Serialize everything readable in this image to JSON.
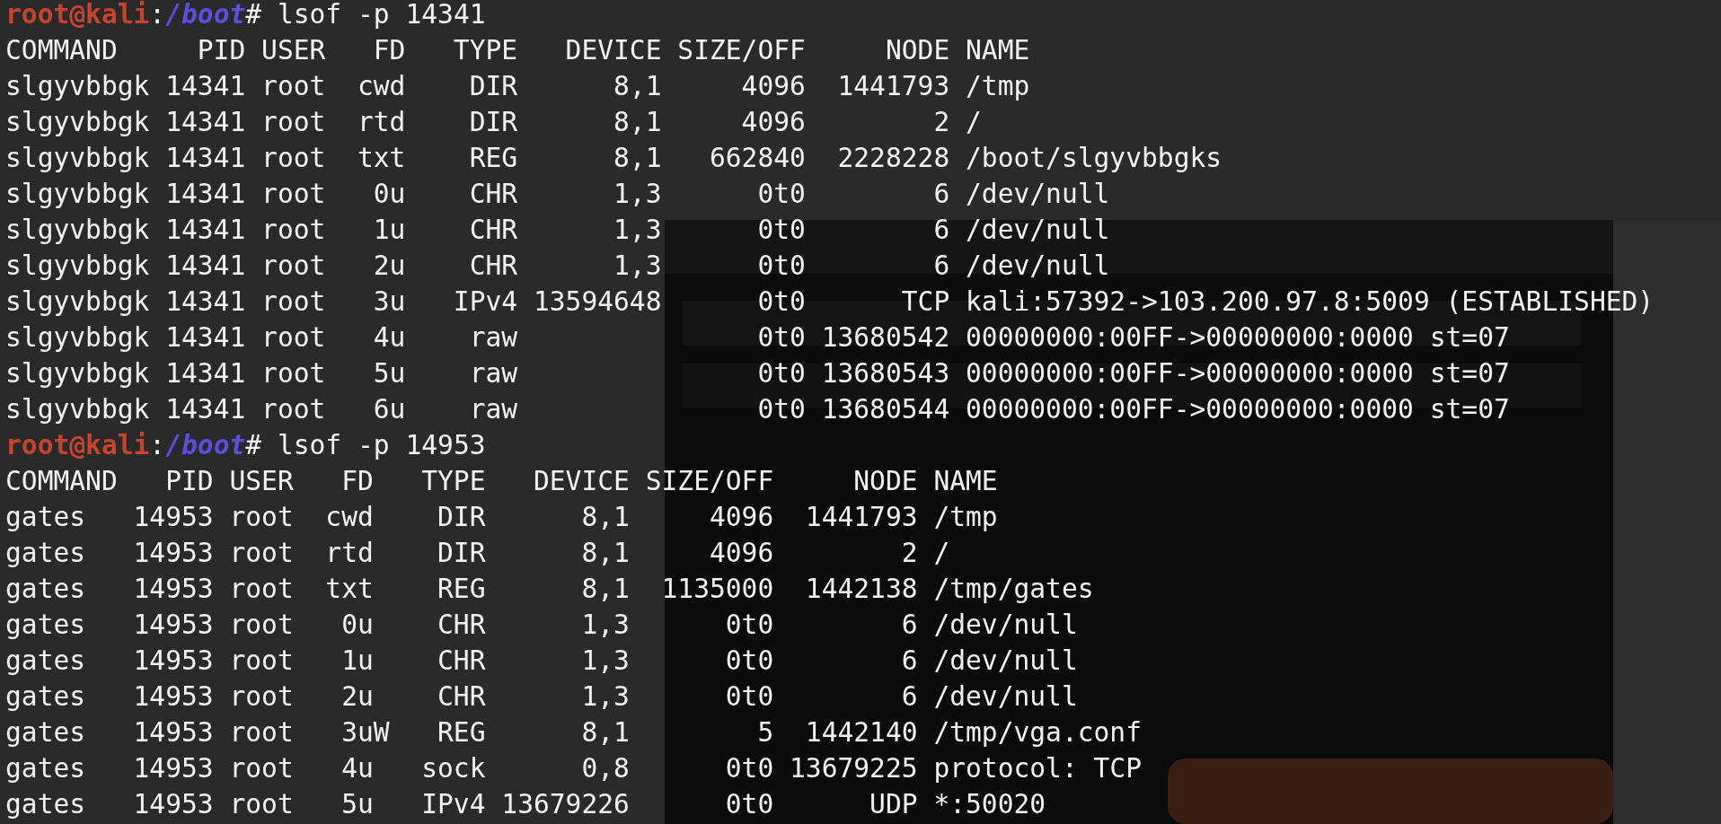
{
  "terminal": {
    "lines": [
      {
        "kind": "prompt",
        "user": "root@kali",
        "sep": ":",
        "path": "/boot",
        "command": "# lsof -p 14341"
      },
      {
        "kind": "output",
        "text": "COMMAND     PID USER   FD   TYPE   DEVICE SIZE/OFF     NODE NAME"
      },
      {
        "kind": "output",
        "text": "slgyvbbgk 14341 root  cwd    DIR      8,1     4096  1441793 /tmp"
      },
      {
        "kind": "output",
        "text": "slgyvbbgk 14341 root  rtd    DIR      8,1     4096        2 /"
      },
      {
        "kind": "output",
        "text": "slgyvbbgk 14341 root  txt    REG      8,1   662840  2228228 /boot/slgyvbbgks"
      },
      {
        "kind": "output",
        "text": "slgyvbbgk 14341 root   0u    CHR      1,3      0t0        6 /dev/null"
      },
      {
        "kind": "output",
        "text": "slgyvbbgk 14341 root   1u    CHR      1,3      0t0        6 /dev/null"
      },
      {
        "kind": "output",
        "text": "slgyvbbgk 14341 root   2u    CHR      1,3      0t0        6 /dev/null"
      },
      {
        "kind": "output",
        "text": "slgyvbbgk 14341 root   3u   IPv4 13594648      0t0      TCP kali:57392->103.200.97.8:5009 (ESTABLISHED)"
      },
      {
        "kind": "output",
        "text": "slgyvbbgk 14341 root   4u    raw               0t0 13680542 00000000:00FF->00000000:0000 st=07"
      },
      {
        "kind": "output",
        "text": "slgyvbbgk 14341 root   5u    raw               0t0 13680543 00000000:00FF->00000000:0000 st=07"
      },
      {
        "kind": "output",
        "text": "slgyvbbgk 14341 root   6u    raw               0t0 13680544 00000000:00FF->00000000:0000 st=07"
      },
      {
        "kind": "prompt",
        "user": "root@kali",
        "sep": ":",
        "path": "/boot",
        "command": "# lsof -p 14953"
      },
      {
        "kind": "output",
        "text": "COMMAND   PID USER   FD   TYPE   DEVICE SIZE/OFF     NODE NAME"
      },
      {
        "kind": "output",
        "text": "gates   14953 root  cwd    DIR      8,1     4096  1441793 /tmp"
      },
      {
        "kind": "output",
        "text": "gates   14953 root  rtd    DIR      8,1     4096        2 /"
      },
      {
        "kind": "output",
        "text": "gates   14953 root  txt    REG      8,1  1135000  1442138 /tmp/gates"
      },
      {
        "kind": "output",
        "text": "gates   14953 root   0u    CHR      1,3      0t0        6 /dev/null"
      },
      {
        "kind": "output",
        "text": "gates   14953 root   1u    CHR      1,3      0t0        6 /dev/null"
      },
      {
        "kind": "output",
        "text": "gates   14953 root   2u    CHR      1,3      0t0        6 /dev/null"
      },
      {
        "kind": "output",
        "text": "gates   14953 root   3uW   REG      8,1        5  1442140 /tmp/vga.conf"
      },
      {
        "kind": "output",
        "text": "gates   14953 root   4u   sock      0,8      0t0 13679225 protocol: TCP"
      },
      {
        "kind": "output",
        "text": "gates   14953 root   5u   IPv4 13679226      0t0      UDP *:50020"
      }
    ]
  }
}
